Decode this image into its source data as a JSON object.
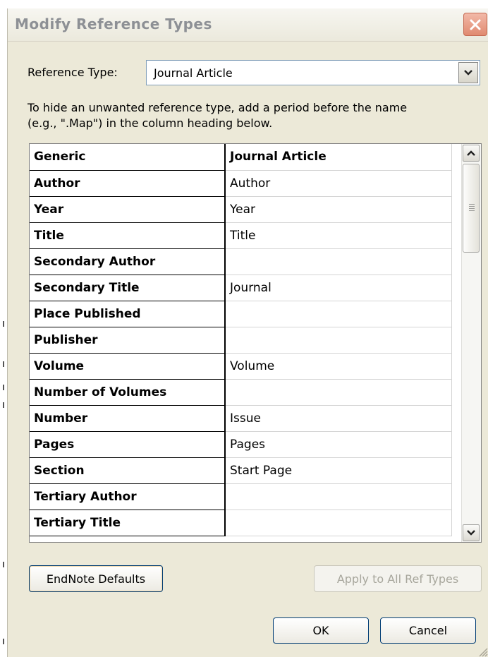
{
  "window": {
    "title": "Modify Reference Types",
    "close_icon": "close-x-icon"
  },
  "reference_type": {
    "label": "Reference Type:",
    "selected": "Journal Article"
  },
  "instructions": {
    "line1": "To hide an unwanted reference type, add a period before the name",
    "line2": "(e.g., \".Map\") in the column heading below."
  },
  "grid": {
    "header": {
      "generic": "Generic",
      "type": "Journal Article"
    },
    "rows": [
      {
        "generic": "Author",
        "type": "Author"
      },
      {
        "generic": "Year",
        "type": "Year"
      },
      {
        "generic": "Title",
        "type": "Title"
      },
      {
        "generic": "Secondary Author",
        "type": ""
      },
      {
        "generic": "Secondary Title",
        "type": "Journal"
      },
      {
        "generic": "Place Published",
        "type": ""
      },
      {
        "generic": "Publisher",
        "type": ""
      },
      {
        "generic": "Volume",
        "type": "Volume"
      },
      {
        "generic": "Number of Volumes",
        "type": ""
      },
      {
        "generic": "Number",
        "type": "Issue"
      },
      {
        "generic": "Pages",
        "type": "Pages"
      },
      {
        "generic": "Section",
        "type": "Start Page"
      },
      {
        "generic": "Tertiary Author",
        "type": ""
      },
      {
        "generic": "Tertiary Title",
        "type": ""
      }
    ]
  },
  "buttons": {
    "defaults": "EndNote Defaults",
    "apply_all": "Apply to All Ref Types",
    "ok": "OK",
    "cancel": "Cancel"
  },
  "colors": {
    "dialog_bg": "#ece9d8",
    "close_button": "#e08a70",
    "button_border": "#003c74",
    "disabled_text": "#a7a69c"
  }
}
